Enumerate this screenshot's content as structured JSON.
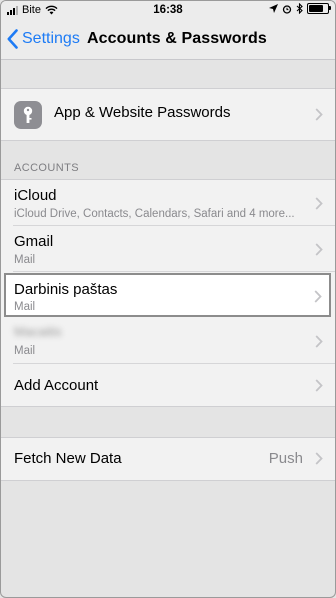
{
  "status_bar": {
    "carrier": "Bite",
    "time": "16:38"
  },
  "nav": {
    "back_label": "Settings",
    "title": "Accounts & Passwords"
  },
  "passwords_row": {
    "label": "App & Website Passwords",
    "icon": "key-icon"
  },
  "accounts": {
    "header": "ACCOUNTS",
    "items": [
      {
        "name": "iCloud",
        "detail": "iCloud Drive, Contacts, Calendars, Safari and 4 more..."
      },
      {
        "name": "Gmail",
        "detail": "Mail"
      },
      {
        "name": "Darbinis paštas",
        "detail": "Mail"
      },
      {
        "name": "Macaitis",
        "detail": "Mail"
      }
    ],
    "add_label": "Add Account"
  },
  "fetch": {
    "label": "Fetch New Data",
    "value": "Push"
  },
  "colors": {
    "accent": "#1d7bf5",
    "background": "#e4e4e4",
    "cell": "#f2f2f2"
  }
}
